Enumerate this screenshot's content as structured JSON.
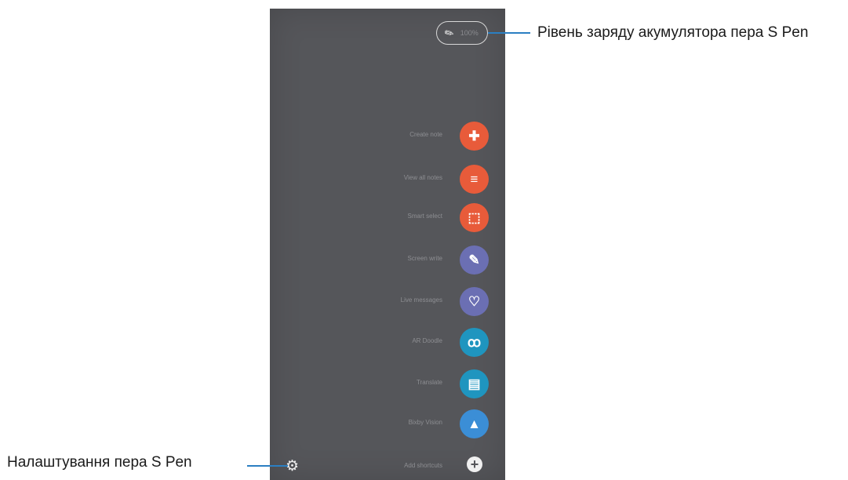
{
  "battery": {
    "pen_icon": "pen-icon",
    "level_text": "100%"
  },
  "menu": [
    {
      "label": "Create note",
      "icon": "create-note-icon",
      "glyph": "✚",
      "color": "#e85b3a"
    },
    {
      "label": "View all notes",
      "icon": "view-notes-icon",
      "glyph": "≡",
      "color": "#e85b3a"
    },
    {
      "label": "Smart select",
      "icon": "smart-select-icon",
      "glyph": "⬚",
      "color": "#e85b3a"
    },
    {
      "label": "Screen write",
      "icon": "screen-write-icon",
      "glyph": "✎",
      "color": "#6b6fb3"
    },
    {
      "label": "Live messages",
      "icon": "live-messages-icon",
      "glyph": "♡",
      "color": "#6b6fb3"
    },
    {
      "label": "AR Doodle",
      "icon": "ar-doodle-icon",
      "glyph": "ꝏ",
      "color": "#1f95bf"
    },
    {
      "label": "Translate",
      "icon": "translate-icon",
      "glyph": "▤",
      "color": "#1f95bf"
    },
    {
      "label": "Bixby Vision",
      "icon": "bixby-vision-icon",
      "glyph": "▲",
      "color": "#3b8ed6"
    }
  ],
  "bottom": {
    "add_label": "Add shortcuts",
    "settings_icon": "gear-icon",
    "add_icon": "plus-icon"
  },
  "callouts": {
    "battery": "Рівень заряду акумулятора пера S Pen",
    "settings": "Налаштування пера S Pen"
  }
}
